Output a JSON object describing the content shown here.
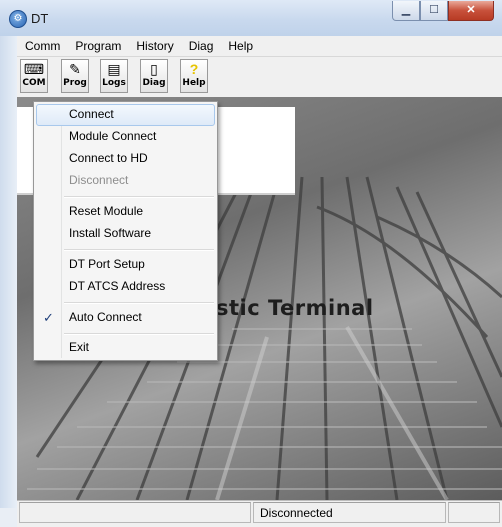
{
  "window": {
    "title": "DT",
    "minimize_glyph": "▁",
    "maximize_glyph": "☐",
    "close_glyph": "✕"
  },
  "menubar": {
    "items": [
      {
        "label": "Comm"
      },
      {
        "label": "Program"
      },
      {
        "label": "History"
      },
      {
        "label": "Diag"
      },
      {
        "label": "Help"
      }
    ]
  },
  "toolbar": {
    "buttons": [
      {
        "label": "COM",
        "icon": "com-port-icon",
        "glyph": "⌨"
      },
      {
        "label": "Prog",
        "icon": "program-icon",
        "glyph": "✎"
      },
      {
        "label": "Logs",
        "icon": "logs-icon",
        "glyph": "▤"
      },
      {
        "label": "Diag",
        "icon": "diag-icon",
        "glyph": "▯"
      },
      {
        "label": "Help",
        "icon": "help-icon",
        "glyph": "?"
      }
    ]
  },
  "main": {
    "banner_visible_text": "stic Terminal"
  },
  "comm_menu": {
    "items": [
      {
        "label": "Connect",
        "highlighted": true
      },
      {
        "label": "Module Connect"
      },
      {
        "label": "Connect to HD"
      },
      {
        "label": "Disconnect",
        "disabled": true
      },
      {
        "label": "Reset Module"
      },
      {
        "label": "Install Software"
      },
      {
        "label": "DT Port Setup"
      },
      {
        "label": "DT ATCS Address"
      },
      {
        "label": "Auto Connect",
        "checked": true,
        "check_glyph": "✓"
      },
      {
        "label": "Exit"
      }
    ]
  },
  "statusbar": {
    "status": "Disconnected"
  }
}
